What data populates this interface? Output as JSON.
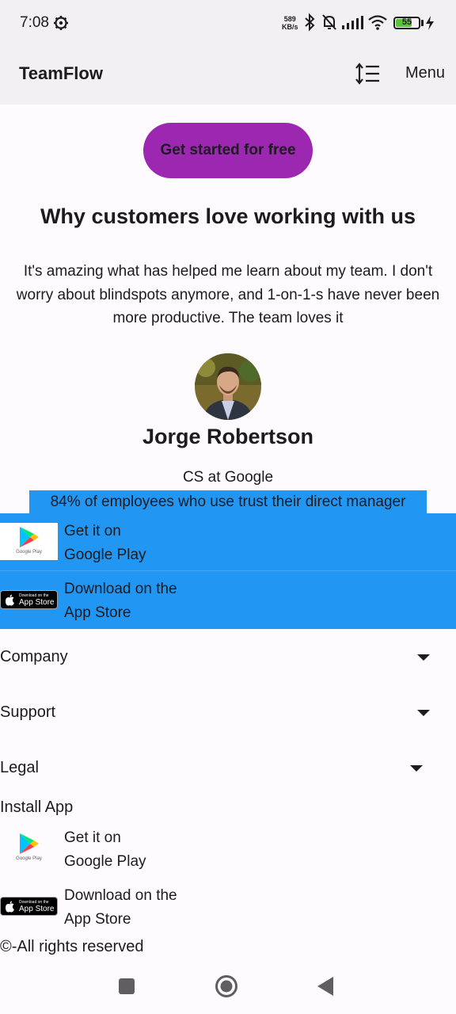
{
  "status_bar": {
    "time": "7:08",
    "net_speed_value": "589",
    "net_speed_unit": "KB/s",
    "battery": "55"
  },
  "app_bar": {
    "title": "TeamFlow",
    "menu_label": "Menu"
  },
  "hero": {
    "cta_label": "Get started for free"
  },
  "testimonial": {
    "section_title": "Why customers love working with us",
    "quote": "It's amazing what has helped me learn about my team. I don't worry about blindspots anymore, and 1-on-1-s have never been more productive. The team loves it",
    "name": "Jorge Robertson",
    "role": "CS at Google",
    "stat": "84% of employees who use trust their direct manager"
  },
  "stores": {
    "google_play": {
      "line1": "Get it on",
      "line2": "Google Play",
      "badge_caption": "Google Play"
    },
    "app_store": {
      "line1": "Download on the",
      "line2": "App Store",
      "badge_small": "Download on the",
      "badge_big": "App Store"
    }
  },
  "footer": {
    "accordions": [
      "Company",
      "Support",
      "Legal"
    ],
    "install_label": "Install App",
    "copyright": "©-All rights reserved"
  },
  "colors": {
    "accent_purple": "#9c27b0",
    "highlight_blue": "#2196f3",
    "app_bar_bg": "#f3f0f4",
    "page_bg": "#fefbfe"
  },
  "icons": {
    "status": [
      "gear-icon",
      "bluetooth-icon",
      "bell-off-icon",
      "signal-icon",
      "wifi-icon",
      "battery-icon",
      "charging-icon"
    ],
    "app_bar": [
      "sort-icon"
    ],
    "nav": [
      "recent-apps-icon",
      "home-icon",
      "back-icon"
    ]
  }
}
